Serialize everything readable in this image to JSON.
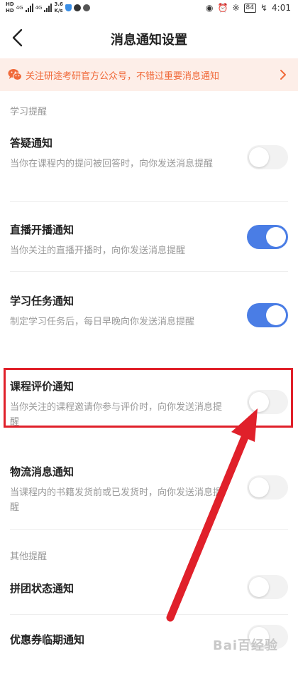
{
  "status_bar": {
    "hd_top": "HD",
    "hd_bottom": "HD",
    "net1": "4G",
    "net2": "4G",
    "speed": "3.6",
    "speed_unit": "K/s",
    "battery": "84",
    "time": "4:01"
  },
  "nav": {
    "title": "消息通知设置"
  },
  "banner": {
    "text": "关注研途考研官方公众号，不错过重要消息通知",
    "color": "#f06a3a",
    "background": "#fdeee8"
  },
  "sections": {
    "study": "学习提醒",
    "other": "其他提醒"
  },
  "settings": [
    {
      "title": "答疑通知",
      "desc": "当你在课程内的提问被回答时，向你发送消息提醒",
      "enabled": false
    },
    {
      "title": "直播开播通知",
      "desc": "当你关注的直播开播时，向你发送消息提醒",
      "enabled": true
    },
    {
      "title": "学习任务通知",
      "desc": "制定学习任务后，每日早晚向你发送消息提醒",
      "enabled": true
    },
    {
      "title": "课程评价通知",
      "desc": "当你关注的课程邀请你参与评价时，向你发送消息提醒",
      "enabled": false
    },
    {
      "title": "物流消息通知",
      "desc": "当课程内的书籍发货前或已发货时，向你发送消息提醒",
      "enabled": false
    },
    {
      "title": "拼团状态通知",
      "desc": "",
      "enabled": false
    },
    {
      "title": "优惠券临期通知",
      "desc": "",
      "enabled": false
    }
  ],
  "colors": {
    "toggle_on": "#4a7de5",
    "toggle_off": "#f2f2f2",
    "annotation": "#e0202a"
  },
  "watermark": "Bai百经验"
}
